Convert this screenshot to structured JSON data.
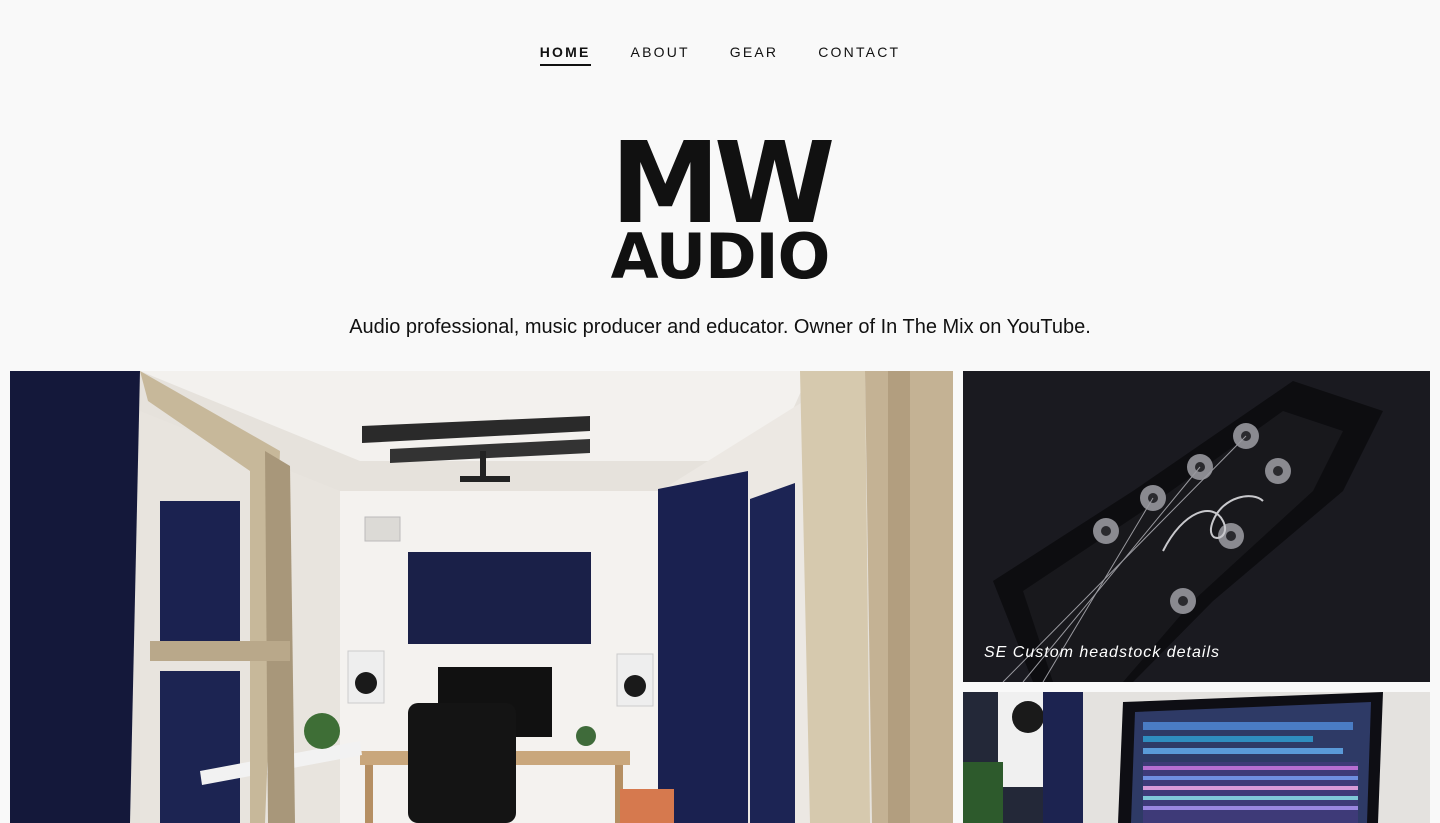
{
  "nav": {
    "items": [
      {
        "label": "HOME",
        "active": true
      },
      {
        "label": "ABOUT",
        "active": false
      },
      {
        "label": "GEAR",
        "active": false
      },
      {
        "label": "CONTACT",
        "active": false
      }
    ]
  },
  "logo": {
    "line1": "MW",
    "line2": "AUDIO"
  },
  "tagline": "Audio professional, music producer and educator. Owner of In The Mix on YouTube.",
  "gallery": {
    "tiles": [
      {
        "caption": ""
      },
      {
        "caption": "SE Custom headstock details"
      },
      {
        "caption": ""
      }
    ]
  },
  "colors": {
    "background": "#f9f9f9",
    "text": "#111111",
    "panel_navy": "#18204a"
  }
}
